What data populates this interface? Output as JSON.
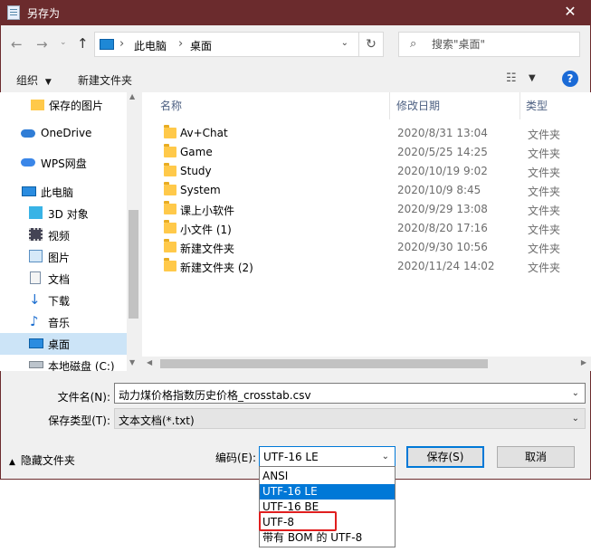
{
  "window": {
    "title": "另存为"
  },
  "address": {
    "crumbs": [
      "此电脑",
      "桌面"
    ]
  },
  "search": {
    "placeholder": "搜索\"桌面\""
  },
  "toolbar": {
    "organize_label": "组织",
    "new_folder_label": "新建文件夹"
  },
  "sidebar": {
    "items": [
      {
        "label": "保存的图片",
        "icon": "folder-icon"
      },
      {
        "label": "OneDrive",
        "icon": "cloud-icon"
      },
      {
        "label": "WPS网盘",
        "icon": "cloud-icon"
      },
      {
        "label": "此电脑",
        "icon": "computer-icon"
      },
      {
        "label": "3D 对象",
        "icon": "cube-icon"
      },
      {
        "label": "视频",
        "icon": "video-icon"
      },
      {
        "label": "图片",
        "icon": "picture-icon"
      },
      {
        "label": "文档",
        "icon": "document-icon"
      },
      {
        "label": "下载",
        "icon": "download-icon"
      },
      {
        "label": "音乐",
        "icon": "music-icon"
      },
      {
        "label": "桌面",
        "icon": "desktop-icon",
        "selected": true
      },
      {
        "label": "本地磁盘 (C:)",
        "icon": "drive-icon"
      }
    ]
  },
  "files": {
    "columns": [
      "名称",
      "修改日期",
      "类型"
    ],
    "rows": [
      {
        "name": "Av+Chat",
        "date": "2020/8/31 13:04",
        "type": "文件夹"
      },
      {
        "name": "Game",
        "date": "2020/5/25 14:25",
        "type": "文件夹"
      },
      {
        "name": "Study",
        "date": "2020/10/19 9:02",
        "type": "文件夹"
      },
      {
        "name": "System",
        "date": "2020/10/9 8:45",
        "type": "文件夹"
      },
      {
        "name": "课上小软件",
        "date": "2020/9/29 13:08",
        "type": "文件夹"
      },
      {
        "name": "小文件 (1)",
        "date": "2020/8/20 17:16",
        "type": "文件夹"
      },
      {
        "name": "新建文件夹",
        "date": "2020/9/30 10:56",
        "type": "文件夹"
      },
      {
        "name": "新建文件夹 (2)",
        "date": "2020/11/24 14:02",
        "type": "文件夹"
      }
    ]
  },
  "form": {
    "filename_label": "文件名(N):",
    "filename_value": "动力煤价格指数历史价格_crosstab.csv",
    "filetype_label": "保存类型(T):",
    "filetype_value": "文本文档(*.txt)",
    "hide_folders_label": "隐藏文件夹",
    "encoding_label": "编码(E):",
    "encoding_value": "UTF-16 LE",
    "save_label": "保存(S)",
    "cancel_label": "取消"
  },
  "encoding_options": [
    "ANSI",
    "UTF-16 LE",
    "UTF-16 BE",
    "UTF-8",
    "带有 BOM 的 UTF-8"
  ],
  "encoding_highlighted": "UTF-16 LE",
  "encoding_marked": "UTF-8",
  "colors": {
    "titlebar": "#6b2b2d",
    "accent": "#0078d7",
    "marker": "#e01e1e",
    "folder": "#ffc94a"
  }
}
